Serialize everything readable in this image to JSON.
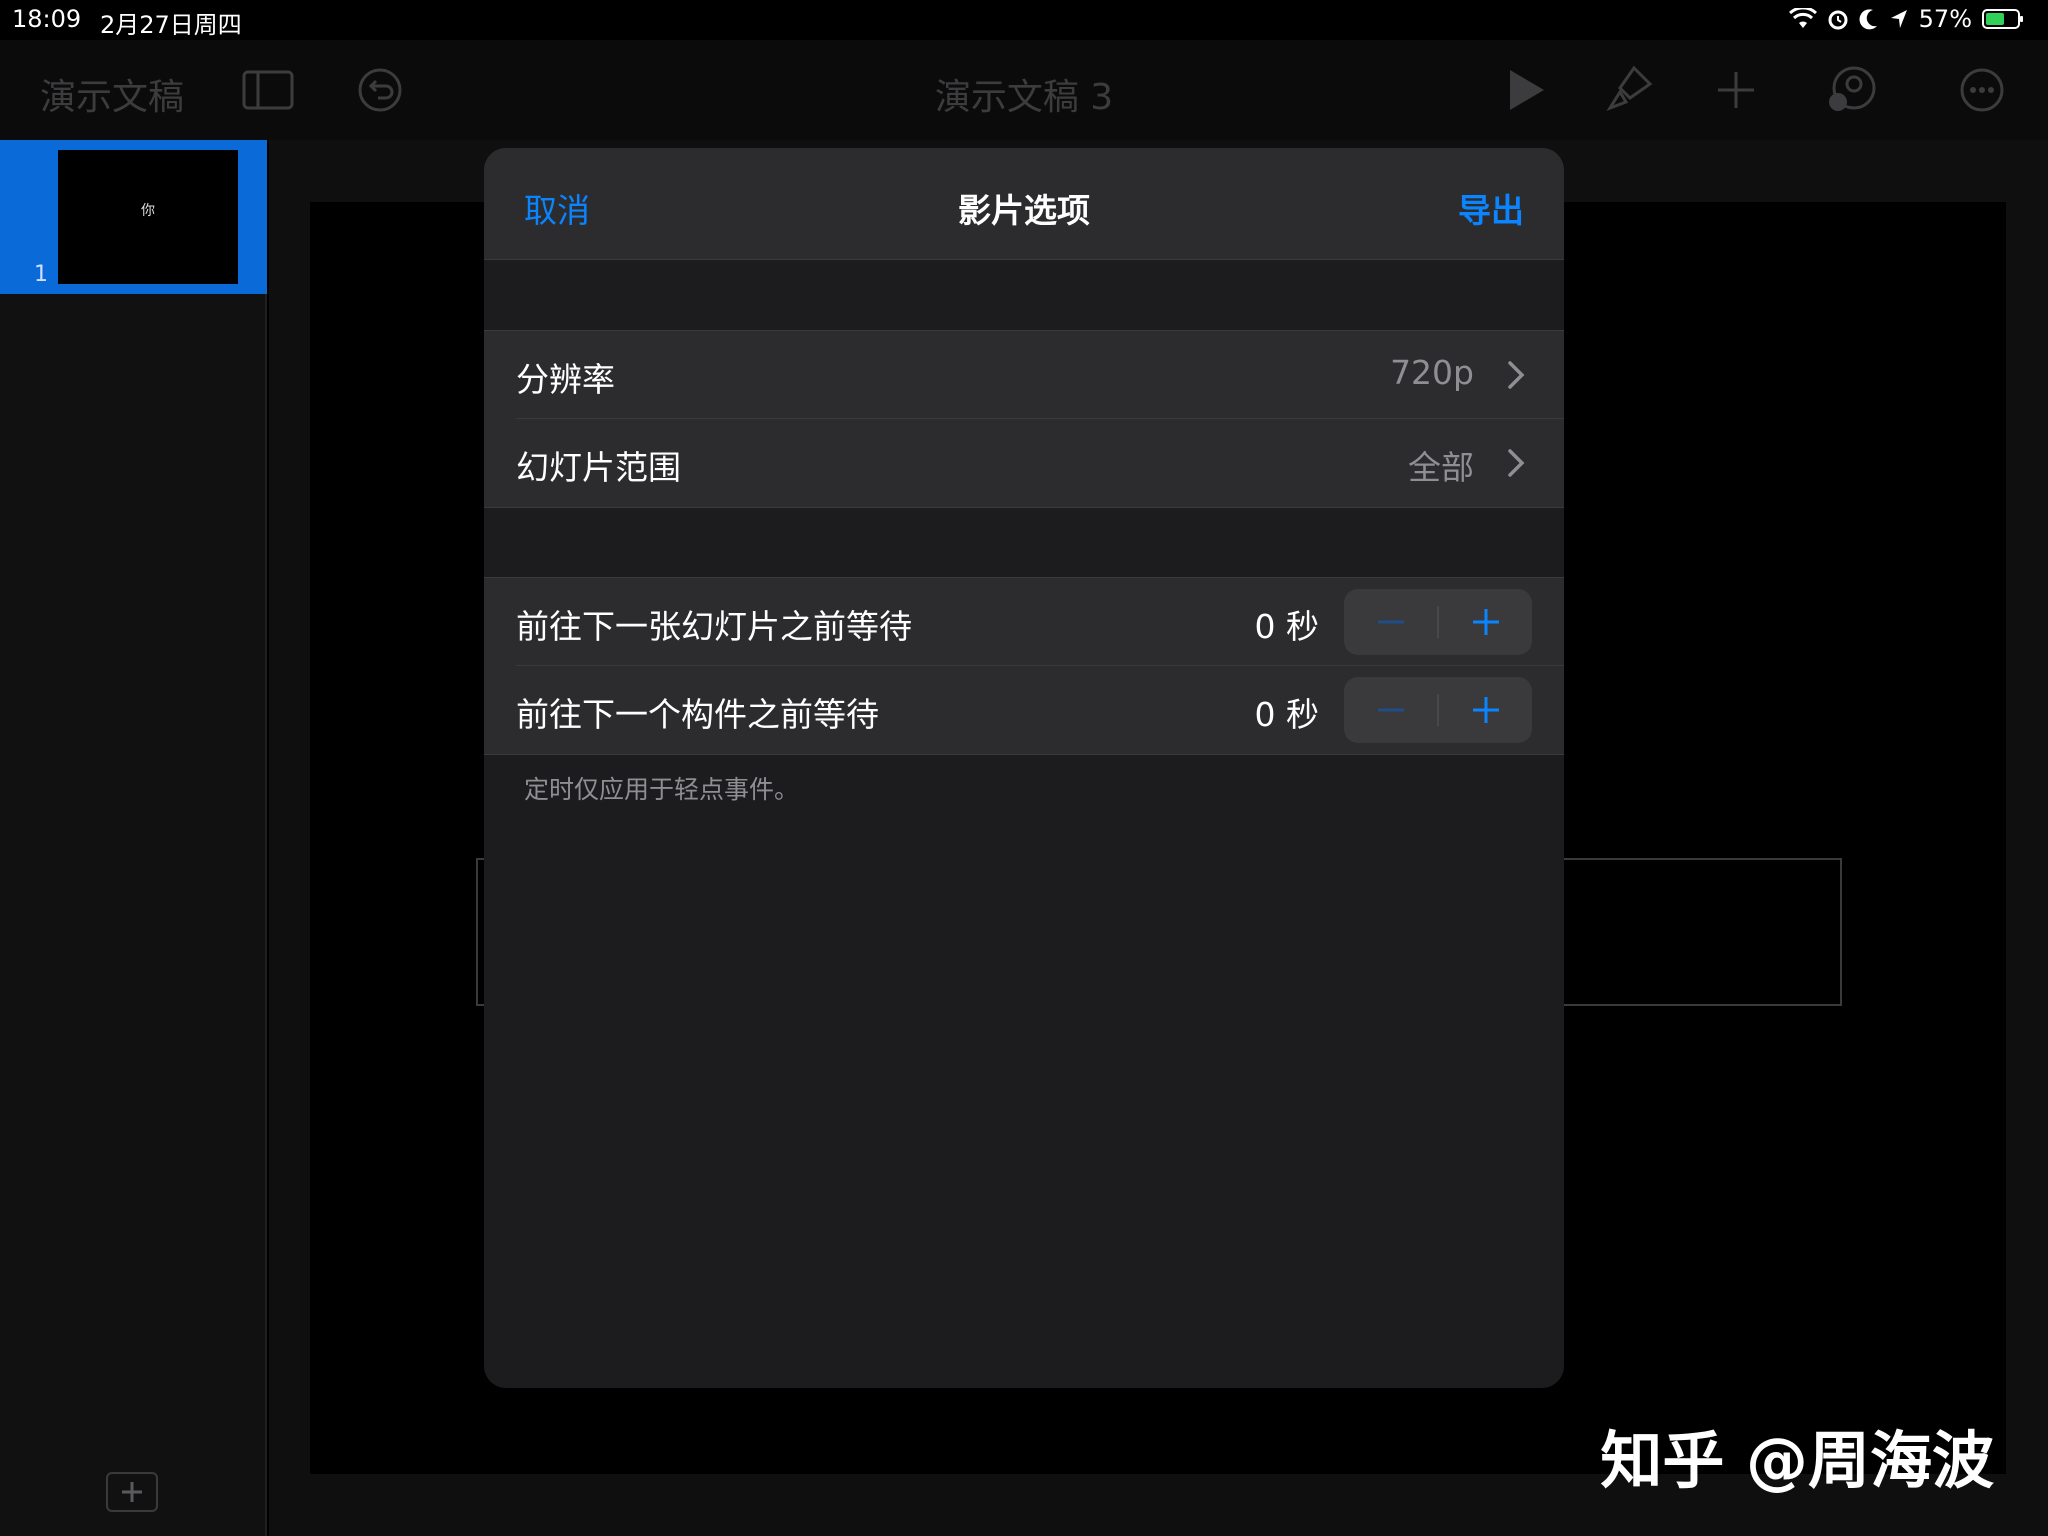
{
  "status_bar": {
    "time": "18:09",
    "date": "2月27日周四",
    "battery": "57%"
  },
  "toolbar": {
    "documents_label": "演示文稿",
    "doc_title": "演示文稿 3"
  },
  "sidebar": {
    "slides": [
      {
        "number": "1",
        "text": "你"
      }
    ]
  },
  "modal": {
    "cancel_label": "取消",
    "title": "影片选项",
    "export_label": "导出",
    "resolution": {
      "label": "分辨率",
      "value": "720p"
    },
    "slide_range": {
      "label": "幻灯片范围",
      "value": "全部"
    },
    "wait_next_slide": {
      "label": "前往下一张幻灯片之前等待",
      "value": "0 秒"
    },
    "wait_next_build": {
      "label": "前往下一个构件之前等待",
      "value": "0 秒"
    },
    "footnote": "定时仅应用于轻点事件。"
  },
  "watermark": "知乎 @周海波",
  "colors": {
    "accent": "#0a84ff",
    "selection": "#0a6bd8",
    "modal_bg": "#1c1c1e",
    "row_bg": "#2c2c2e"
  }
}
